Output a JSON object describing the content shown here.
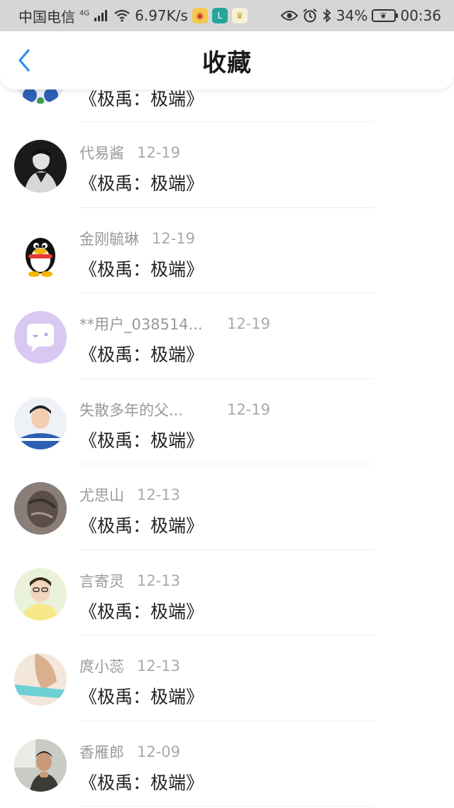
{
  "status_bar": {
    "carrier": "中国电信",
    "network": "4G",
    "speed": "6.97K/s",
    "battery": "34%",
    "time": "00:36"
  },
  "header": {
    "title": "收藏"
  },
  "items": [
    {
      "name": "",
      "date": "",
      "book": "《极禹：极端》"
    },
    {
      "name": "代易酱",
      "date": "12-19",
      "book": "《极禹：极端》"
    },
    {
      "name": "金刚毓琳",
      "date": "12-19",
      "book": "《极禹：极端》"
    },
    {
      "name": "**用户_038514...",
      "date": "12-19",
      "book": "《极禹：极端》"
    },
    {
      "name": "失散多年的父...",
      "date": "12-19",
      "book": "《极禹：极端》"
    },
    {
      "name": "尤思山",
      "date": "12-13",
      "book": "《极禹：极端》"
    },
    {
      "name": "言寄灵",
      "date": "12-13",
      "book": "《极禹：极端》"
    },
    {
      "name": "庹小蕊",
      "date": "12-13",
      "book": "《极禹：极端》"
    },
    {
      "name": "香雁郎",
      "date": "12-09",
      "book": "《极禹：极端》"
    }
  ],
  "colors": {
    "accent": "#2f8ef0",
    "status_bar_bg": "#d6d6d6",
    "meta_text": "#999999"
  }
}
